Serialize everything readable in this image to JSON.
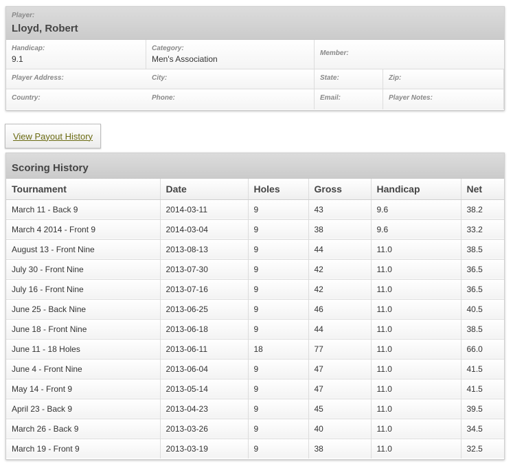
{
  "player": {
    "label": "Player:",
    "name": "Lloyd, Robert",
    "handicap_label": "Handicap:",
    "handicap": "9.1",
    "category_label": "Category:",
    "category": "Men's Association",
    "member_label": "Member:",
    "address_label": "Player Address:",
    "city_label": "City:",
    "state_label": "State:",
    "zip_label": "Zip:",
    "country_label": "Country:",
    "phone_label": "Phone:",
    "email_label": "Email:",
    "notes_label": "Player Notes:"
  },
  "payout_button": "View Payout History",
  "scoring": {
    "title": "Scoring History",
    "columns": [
      "Tournament",
      "Date",
      "Holes",
      "Gross",
      "Handicap",
      "Net"
    ],
    "rows": [
      [
        "March 11 - Back 9",
        "2014-03-11",
        "9",
        "43",
        "9.6",
        "38.2"
      ],
      [
        "March 4 2014 - Front 9",
        "2014-03-04",
        "9",
        "38",
        "9.6",
        "33.2"
      ],
      [
        "August 13 - Front Nine",
        "2013-08-13",
        "9",
        "44",
        "11.0",
        "38.5"
      ],
      [
        "July 30 - Front Nine",
        "2013-07-30",
        "9",
        "42",
        "11.0",
        "36.5"
      ],
      [
        "July 16 - Front Nine",
        "2013-07-16",
        "9",
        "42",
        "11.0",
        "36.5"
      ],
      [
        "June 25 - Back Nine",
        "2013-06-25",
        "9",
        "46",
        "11.0",
        "40.5"
      ],
      [
        "June 18 - Front Nine",
        "2013-06-18",
        "9",
        "44",
        "11.0",
        "38.5"
      ],
      [
        "June 11 - 18 Holes",
        "2013-06-11",
        "18",
        "77",
        "11.0",
        "66.0"
      ],
      [
        "June 4 - Front Nine",
        "2013-06-04",
        "9",
        "47",
        "11.0",
        "41.5"
      ],
      [
        "May 14 - Front 9",
        "2013-05-14",
        "9",
        "47",
        "11.0",
        "41.5"
      ],
      [
        "April 23 - Back 9",
        "2013-04-23",
        "9",
        "45",
        "11.0",
        "39.5"
      ],
      [
        "March 26 - Back 9",
        "2013-03-26",
        "9",
        "40",
        "11.0",
        "34.5"
      ],
      [
        "March 19 - Front 9",
        "2013-03-19",
        "9",
        "38",
        "11.0",
        "32.5"
      ]
    ]
  }
}
